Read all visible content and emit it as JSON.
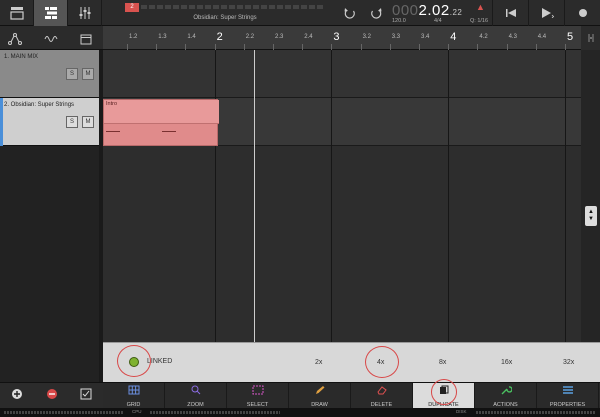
{
  "toolbar": {
    "track_name": "Obsidian: Super Strings",
    "mini_index": "2",
    "position": {
      "prefix": "000",
      "main": "2.02",
      "ticks": ".22"
    },
    "tempo": "120.0",
    "time_signature": "4/4",
    "quantize": "Q: 1/16"
  },
  "ruler": {
    "labels": [
      {
        "t": "1.2",
        "major": false
      },
      {
        "t": "1.3",
        "major": false
      },
      {
        "t": "1.4",
        "major": false
      },
      {
        "t": "2",
        "major": true
      },
      {
        "t": "2.2",
        "major": false
      },
      {
        "t": "2.3",
        "major": false
      },
      {
        "t": "2.4",
        "major": false
      },
      {
        "t": "3",
        "major": true
      },
      {
        "t": "3.2",
        "major": false
      },
      {
        "t": "3.3",
        "major": false
      },
      {
        "t": "3.4",
        "major": false
      },
      {
        "t": "4",
        "major": true
      },
      {
        "t": "4.2",
        "major": false
      },
      {
        "t": "4.3",
        "major": false
      },
      {
        "t": "4.4",
        "major": false
      },
      {
        "t": "5",
        "major": true
      }
    ]
  },
  "tracks": [
    {
      "title": "1. MAIN MIX",
      "solo": "S",
      "mute": "M"
    },
    {
      "title": "2. Obsidian: Super Strings",
      "solo": "S",
      "mute": "M"
    }
  ],
  "clip": {
    "name": "Intro"
  },
  "duplicate_panel": {
    "linked_label": "LINKED",
    "multipliers": [
      "2x",
      "4x",
      "8x",
      "16x",
      "32x"
    ]
  },
  "tools": [
    {
      "label": "GRID",
      "icon": "grid-icon"
    },
    {
      "label": "ZOOM",
      "icon": "zoom-icon"
    },
    {
      "label": "SELECT",
      "icon": "select-icon"
    },
    {
      "label": "DRAW",
      "icon": "pencil-icon"
    },
    {
      "label": "DELETE",
      "icon": "eraser-icon"
    },
    {
      "label": "DUPLICATE",
      "icon": "duplicate-icon"
    },
    {
      "label": "ACTIONS",
      "icon": "wrench-icon"
    },
    {
      "label": "PROPERTIES",
      "icon": "list-icon"
    }
  ],
  "status": {
    "cpu_label": "CPU",
    "disk_label": "DISK"
  },
  "colors": {
    "clip": "#e08b8b",
    "accent": "#4a8fd9",
    "linked": "#7fb230",
    "annotation": "#d84848"
  }
}
